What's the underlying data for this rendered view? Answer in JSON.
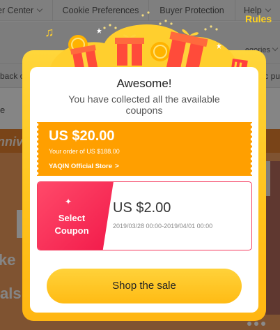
{
  "background": {
    "topbar": {
      "items": [
        "er Center",
        "Cookie Preferences",
        "Buyer Protection",
        "Help"
      ]
    },
    "nav": {
      "left_text": "back o",
      "right_text": "c pu",
      "categories_fragment": "egories"
    },
    "banner": {
      "anniversary_fragment": "nniv",
      "ke_fragment": "ke",
      "als_fragment": "als",
      "e_fragment": "e"
    }
  },
  "rules_link": "Rules",
  "modal": {
    "title": "Awesome!",
    "subtitle": "You have collected all the available coupons",
    "coupon_store": {
      "amount": "US $20.00",
      "condition": "Your order of US $188.00",
      "store_name": "YAQIN Official Store",
      "arrow": ">"
    },
    "coupon_select": {
      "star": "✦",
      "label": "Select Coupon",
      "amount": "US $2.00",
      "dates": "2019/03/28 00:00-2019/04/01 00:00"
    },
    "cta_label": "Shop the sale"
  },
  "colors": {
    "accent_yellow": "#ffc21b",
    "coupon_orange": "#ff9f00",
    "coupon_pink": "#f21a4a",
    "rules_yellow": "#ffd21d"
  }
}
